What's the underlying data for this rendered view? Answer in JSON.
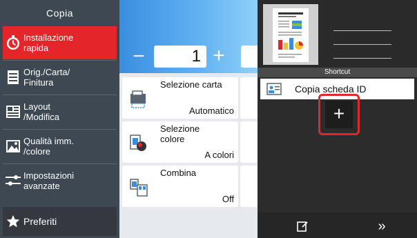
{
  "sidebar": {
    "title": "Copia",
    "items": [
      {
        "label": "Installazione\nrapida",
        "icon": "timer-icon",
        "active": true
      },
      {
        "label": "Orig./Carta/\nFinitura",
        "icon": "document-lines-icon",
        "active": false
      },
      {
        "label": "Layout\n/Modifica",
        "icon": "layout-grid-icon",
        "active": false
      },
      {
        "label": "Qualità imm.\n/colore",
        "icon": "image-quality-icon",
        "active": false
      },
      {
        "label": "Impostazioni\navanzate",
        "icon": "sliders-icon",
        "active": false
      }
    ],
    "favorites": {
      "label": "Preferiti",
      "icon": "star-icon"
    }
  },
  "copies": {
    "minus": "−",
    "value": "1",
    "plus": "+"
  },
  "functions": [
    {
      "title": "Selezione carta",
      "value": "Automatico",
      "icon": "paper-tray-icon"
    },
    {
      "title": "Selezione\ncolore",
      "value": "A colori",
      "icon": "color-select-icon"
    },
    {
      "title": "Combina",
      "value": "Off",
      "icon": "combine-pages-icon"
    }
  ],
  "shortcut_panel": {
    "header": "Shortcut",
    "items": [
      {
        "label": "Copia scheda ID",
        "icon": "id-card-icon"
      }
    ],
    "add_label": "+",
    "more_label": "»",
    "colors": {
      "accent": "#e4262b",
      "panel": "#2c2c2c"
    }
  }
}
